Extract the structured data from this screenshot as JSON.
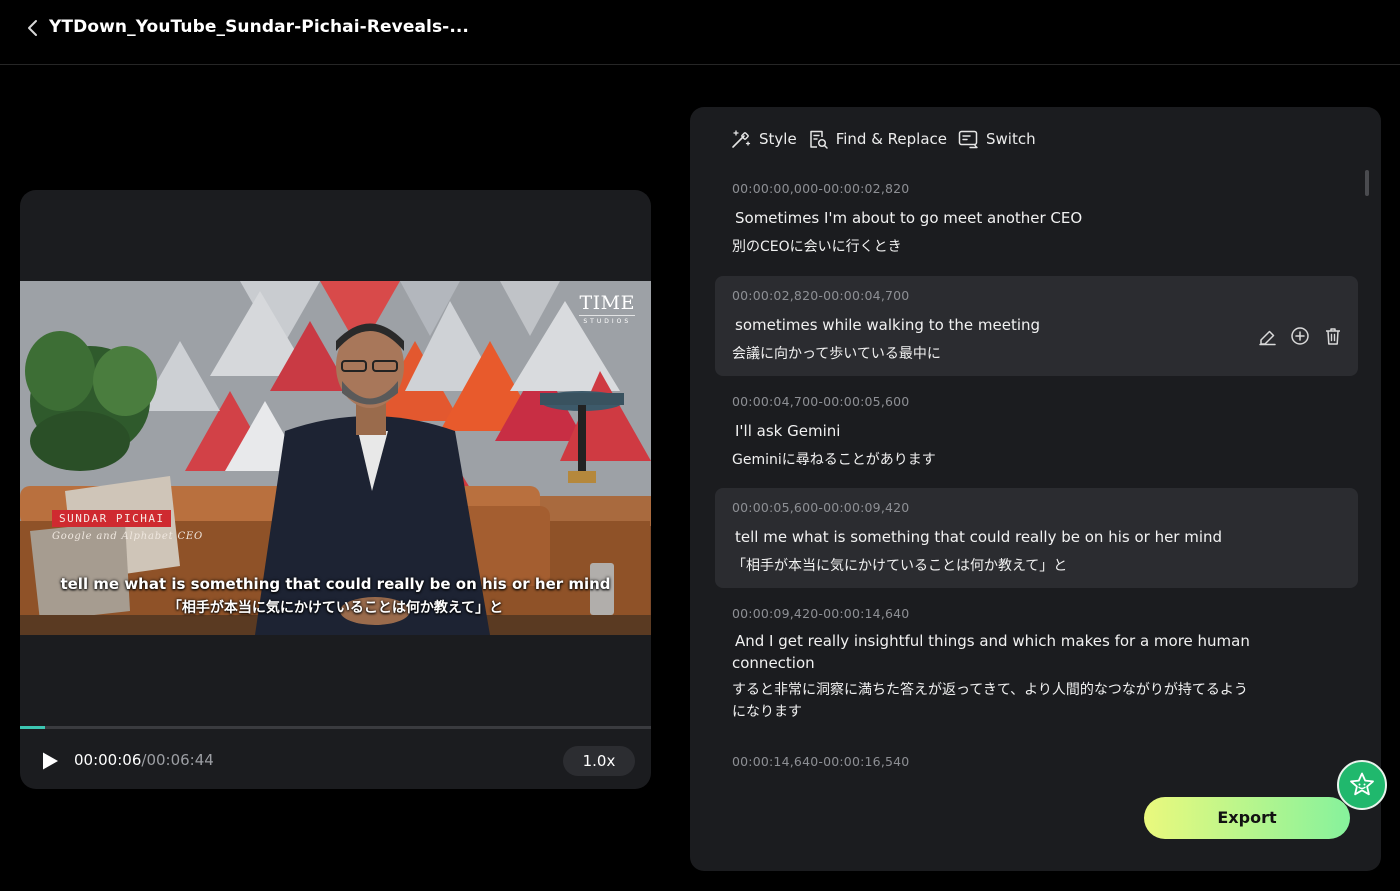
{
  "header": {
    "title": "YTDown_YouTube_Sundar-Pichai-Reveals-..."
  },
  "player": {
    "brand_logo": {
      "line1": "TIME",
      "line2": "STUDIOS"
    },
    "lower_third": {
      "name": "SUNDAR PICHAI",
      "role": "Google and Alphabet CEO"
    },
    "caption_en": "tell me what is something that could really be on his or her mind",
    "caption_ja": "「相手が本当に気にかけていることは何か教えて」と",
    "current_time": "00:00:06",
    "separator": "/",
    "total_time": "00:06:44",
    "speed": "1.0x",
    "progress_fraction": 0.0149
  },
  "toolbar": {
    "style_label": "Style",
    "find_replace_label": "Find & Replace",
    "switch_label": "Switch"
  },
  "segments": [
    {
      "time": "00:00:00,000-00:00:02,820",
      "en": "Sometimes I'm about to go meet another CEO",
      "ja": "別のCEOに会いに行くとき"
    },
    {
      "time": "00:00:02,820-00:00:04,700",
      "en": "sometimes while walking to the meeting",
      "ja": "会議に向かって歩いている最中に"
    },
    {
      "time": "00:00:04,700-00:00:05,600",
      "en": "I'll ask Gemini",
      "ja": "Geminiに尋ねることがあります"
    },
    {
      "time": "00:00:05,600-00:00:09,420",
      "en": "tell me what is something that could really be on his or her mind",
      "ja": "「相手が本当に気にかけていることは何か教えて」と"
    },
    {
      "time": "00:00:09,420-00:00:14,640",
      "en": "And I get really insightful things and which makes for a more human connection",
      "ja": "すると非常に洞察に満ちた答えが返ってきて、より人間的なつながりが持てるようになります"
    },
    {
      "time": "00:00:14,640-00:00:16,540",
      "en": "",
      "ja": ""
    }
  ],
  "export": {
    "label": "Export"
  },
  "colors": {
    "background": "#000000",
    "panel": "#1b1c1f",
    "row_highlight": "#2b2c30",
    "progress": "#3cc6b2",
    "export_gradient_start": "#eaf97d",
    "export_gradient_end": "#86f29c",
    "help_button": "#20b86d"
  },
  "icons": {
    "back": "chevron-left-icon",
    "style": "magic-wand-icon",
    "find_replace": "document-search-icon",
    "switch": "subtitle-switch-icon",
    "play": "play-icon",
    "edit": "eraser-icon",
    "add": "plus-circle-icon",
    "delete": "trash-icon",
    "help": "star-smile-icon"
  }
}
